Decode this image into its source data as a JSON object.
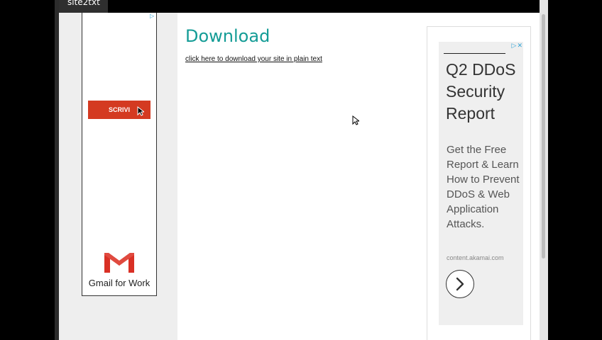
{
  "site": {
    "brand": "site2txt"
  },
  "main": {
    "title": "Download",
    "link": "click here to download your site in plain text"
  },
  "left_ad": {
    "button": "SCRIVI",
    "product": "Gmail for Work",
    "adchoices_icon": "adchoices-triangle-icon",
    "colors": {
      "button": "#d43a21"
    }
  },
  "right_ad": {
    "heading": "Q2 DDoS Security Report",
    "body": "Get the Free Report & Learn How to Prevent DDoS & Web Application Attacks.",
    "domain": "content.akamai.com",
    "arrow_icon": "chevron-right-icon",
    "adchoices_icon": "adchoices-close-icon"
  },
  "colors": {
    "title": "#149c96",
    "background": "#ffffff",
    "sidebar": "#eeeeee"
  }
}
